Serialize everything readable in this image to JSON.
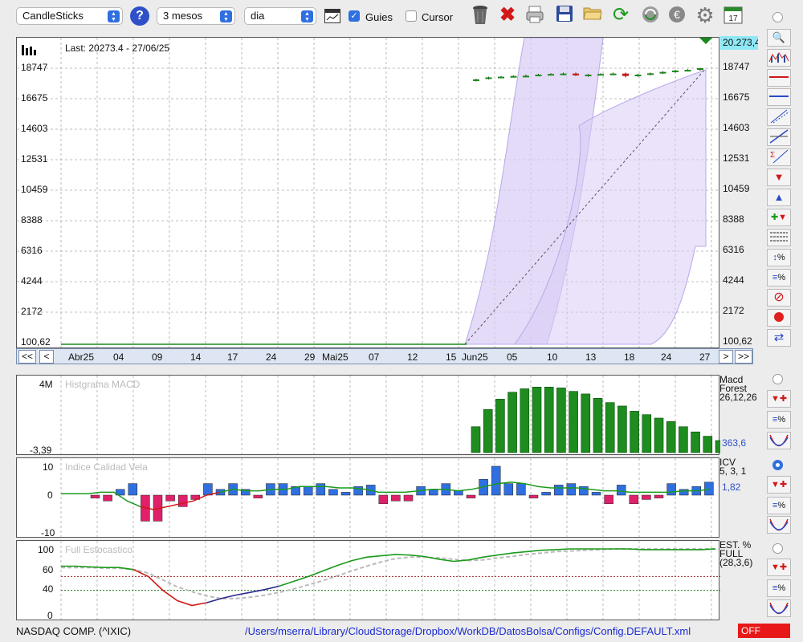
{
  "toolbar": {
    "chart_type": "CandleSticks",
    "period": "3 mesos",
    "interval": "dia",
    "guides_label": "Guies",
    "guides_checked": true,
    "cursor_label": "Cursor",
    "cursor_checked": false,
    "calendar_day": "17",
    "icons": [
      "help-icon",
      "chart-view-icon",
      "trash-icon",
      "delete-icon",
      "print-icon",
      "save-icon",
      "open-folder-icon",
      "refresh-icon",
      "sync-icon",
      "euro-icon",
      "gear-icon",
      "calendar-icon"
    ]
  },
  "main_chart": {
    "last_label": "Last: 20273.4 - 27/06/25",
    "price_tag": "20.273,4",
    "y_ticks": [
      "18747",
      "16675",
      "14603",
      "12531",
      "10459",
      "8388",
      "6316",
      "4244",
      "2172",
      "100,62"
    ],
    "ylim": [
      100.62,
      20273.4
    ],
    "nav": {
      "first": "<<",
      "prev": "<",
      "next": ">",
      "last": ">>",
      "labels": [
        "Abr25",
        "04",
        "09",
        "14",
        "17",
        "24",
        "29",
        "Mai25",
        "07",
        "12",
        "15",
        "Jun25",
        "05",
        "10",
        "13",
        "18",
        "24",
        "27"
      ]
    }
  },
  "chart_data": [
    {
      "type": "bar",
      "title": "Histgrama MACD",
      "ylim": [
        -3.39,
        4000000
      ],
      "y_ticks": [
        "4M",
        "-3,39"
      ],
      "side_label_1": "Macd",
      "side_label_2": "Forest",
      "side_label_3": "26,12,26",
      "last_value": "363,6",
      "values": [
        1500000,
        2500000,
        3100000,
        3500000,
        3700000,
        3800000,
        3800000,
        3750000,
        3550000,
        3400000,
        3150000,
        2900000,
        2700000,
        2400000,
        2200000,
        2000000,
        1800000,
        1500000,
        1200000,
        950000,
        700000,
        400000
      ]
    },
    {
      "type": "bar",
      "title": "Indice Calidad Vela",
      "ylim": [
        -10,
        10
      ],
      "y_ticks": [
        "10",
        "0",
        "-10"
      ],
      "side_label_1": "ICV",
      "side_label_2": "5, 3, 1",
      "last_value": "1,82",
      "values": [
        -1,
        -2,
        2,
        4,
        -9,
        -9,
        -2,
        -4,
        -1.5,
        4,
        2,
        4,
        2,
        -1,
        4,
        4,
        3,
        3,
        4,
        2,
        1,
        3,
        3.5,
        -3,
        -2,
        -2,
        3,
        2,
        4,
        1.5,
        -1,
        5.5,
        10,
        4,
        4,
        -1,
        1,
        3.5,
        4,
        3,
        1,
        -3,
        3.5,
        -3,
        -1.5,
        -1,
        4,
        2,
        3,
        4.5
      ],
      "line": [
        0.5,
        0.5,
        0.5,
        1,
        1,
        -2,
        -4,
        -5,
        -4,
        -3,
        -2,
        0,
        1,
        2,
        1.5,
        1.5,
        2,
        2,
        3,
        3,
        3,
        2.5,
        2.5,
        2,
        1,
        1,
        1,
        1.5,
        2,
        2,
        1.5,
        2,
        3,
        4,
        4.5,
        4,
        3,
        2.5,
        2.5,
        2.5,
        2,
        1.5,
        1.5,
        1,
        1,
        1,
        1,
        1.5,
        1.5,
        2
      ]
    },
    {
      "type": "line",
      "title": "Full Estocastico",
      "ylim": [
        0,
        100
      ],
      "y_ticks": [
        "100",
        "60",
        "40",
        "0"
      ],
      "side_label_1": "EST. %",
      "side_label_2": "FULL",
      "side_label_3": "(28,3,6)",
      "main_line": [
        75,
        75,
        74,
        73,
        73,
        70,
        60,
        40,
        25,
        18,
        22,
        28,
        33,
        37,
        41,
        46,
        53,
        60,
        68,
        76,
        83,
        88,
        90,
        92,
        91,
        89,
        85,
        82,
        84,
        88,
        91,
        94,
        96,
        98,
        99,
        100,
        100,
        100,
        100,
        100,
        99,
        99,
        99,
        99,
        99,
        100
      ],
      "signal_line": [
        73,
        73,
        73,
        72,
        72,
        70,
        65,
        55,
        45,
        38,
        32,
        28,
        28,
        30,
        33,
        37,
        42,
        48,
        54,
        61,
        68,
        75,
        81,
        86,
        88,
        88,
        87,
        85,
        83,
        84,
        87,
        89,
        92,
        94,
        96,
        97,
        98,
        99,
        100,
        100,
        100,
        100,
        100,
        100,
        100,
        100
      ]
    }
  ],
  "candles": [
    [
      19400,
      19500,
      19300,
      19450
    ],
    [
      19500,
      19650,
      19450,
      19600
    ],
    [
      19600,
      19700,
      19550,
      19650
    ],
    [
      19650,
      19750,
      19600,
      19700
    ],
    [
      19700,
      19800,
      19650,
      19720
    ],
    [
      19720,
      19850,
      19700,
      19800
    ],
    [
      19800,
      19900,
      19750,
      19850
    ],
    [
      19850,
      19950,
      19800,
      19880
    ],
    [
      19880,
      19950,
      19700,
      19750
    ],
    [
      19750,
      19850,
      19650,
      19800
    ],
    [
      19800,
      19900,
      19750,
      19850
    ],
    [
      19850,
      19950,
      19800,
      19880
    ],
    [
      19880,
      19950,
      19600,
      19700
    ],
    [
      19700,
      19850,
      19650,
      19800
    ],
    [
      19800,
      19950,
      19750,
      19900
    ],
    [
      19900,
      20050,
      19850,
      20000
    ],
    [
      20000,
      20150,
      19950,
      20100
    ],
    [
      20100,
      20200,
      20050,
      20150
    ],
    [
      20150,
      20300,
      20100,
      20273.4
    ]
  ],
  "footer": {
    "symbol": "NASDAQ COMP. (^IXIC)",
    "path": "/Users/mserra/Library/CloudStorage/Dropbox/WorkDB/DatosBolsa/Configs/Config.DEFAULT.xml",
    "status": "OFF"
  },
  "colors": {
    "green": "#1a8a1a",
    "blue": "#2f6fe0",
    "red": "#d21a1a",
    "pink": "#e0206a",
    "navy": "#2a2a8a",
    "band": "#d9ccf5",
    "macd": "#1e8c1e"
  }
}
